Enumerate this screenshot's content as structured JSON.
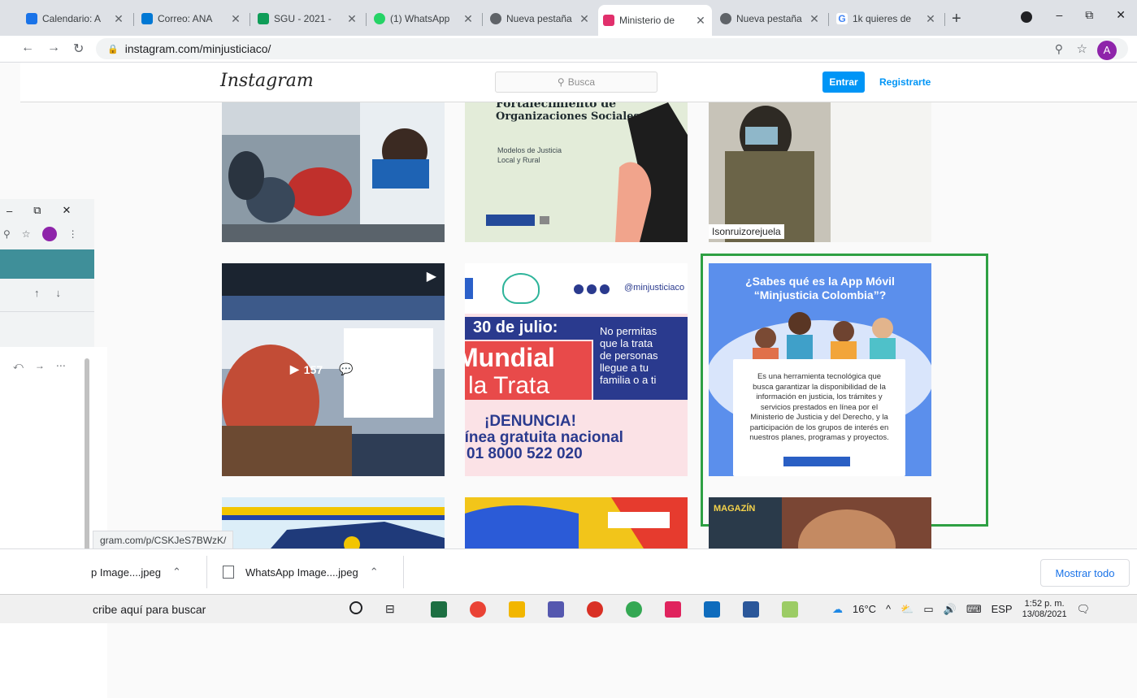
{
  "browser": {
    "tabs": [
      {
        "title": "Calendario: A",
        "favicon_color": "#1a73e8"
      },
      {
        "title": "Correo: ANA",
        "favicon_color": "#0078d4"
      },
      {
        "title": "SGU - 2021 -",
        "favicon_color": "#0f9d58"
      },
      {
        "title": "(1) WhatsApp",
        "favicon_color": "#25d366"
      },
      {
        "title": "Nueva pestaña",
        "favicon_color": "#5f6368"
      },
      {
        "title": "Ministerio de",
        "favicon_color": "#e1306c"
      },
      {
        "title": "Nueva pestaña",
        "favicon_color": "#5f6368"
      },
      {
        "title": "1k quieres de",
        "favicon_color": "#4285f4"
      }
    ],
    "active_tab_index": 5,
    "new_tab_symbol": "+",
    "url": "instagram.com/minjusticiaco/",
    "profile_initial": "A",
    "window_controls": [
      "–",
      "⧉",
      "✕"
    ]
  },
  "instagram": {
    "logo": "Instagram",
    "search_placeholder": "Busca",
    "login_label": "Entrar",
    "register_label": "Registrarte",
    "posts": {
      "p2": {
        "title_line1": "Fortalecimiento de",
        "title_line2": "Organizaciones Sociales",
        "sub1": "Modelos de Justicia",
        "sub2": "Local y Rural"
      },
      "p3": {
        "caption": "Isonruizorejuela"
      },
      "p4": {
        "views": "157",
        "comments": "1"
      },
      "p5": {
        "handle": "@minjusticiaco",
        "date": "30 de julio:",
        "big1": "Mundial",
        "big2": "la Trata",
        "side1": "No permitas",
        "side2": "que la trata",
        "side3": "de personas",
        "side4": "llegue a tu",
        "side5": "familia o a ti",
        "cta": "¡DENUNCIA!",
        "line": "Línea gratuita nacional",
        "phone": "01 8000 522 020"
      },
      "p6": {
        "title1": "¿Sabes qué es la App Móvil",
        "title2": "“Minjusticia Colombia”?",
        "body1": "Es una herramienta tecnológica que",
        "body2": "busca garantizar la disponibilidad de la",
        "body3": "información en justicia, los trámites y",
        "body4": "servicios prestados en línea por el",
        "body5": "Ministerio de Justicia y del Derecho, y la",
        "body6": "participación de los grupos de interés en",
        "body7": "nuestros planes, programas y proyectos."
      },
      "p9": {
        "label": "MAGAZÍN"
      }
    },
    "highlight_color": "#2ea043"
  },
  "status_url": "gram.com/p/CSKJeS7BWzK/",
  "downloads": [
    {
      "name": "p Image....jpeg"
    },
    {
      "name": "WhatsApp Image....jpeg"
    }
  ],
  "show_all_label": "Mostrar todo",
  "taskbar": {
    "search_text": "cribe aquí para buscar",
    "temperature": "16°C",
    "language": "ESP",
    "time": "1:52 p. m.",
    "date": "13/08/2021"
  }
}
